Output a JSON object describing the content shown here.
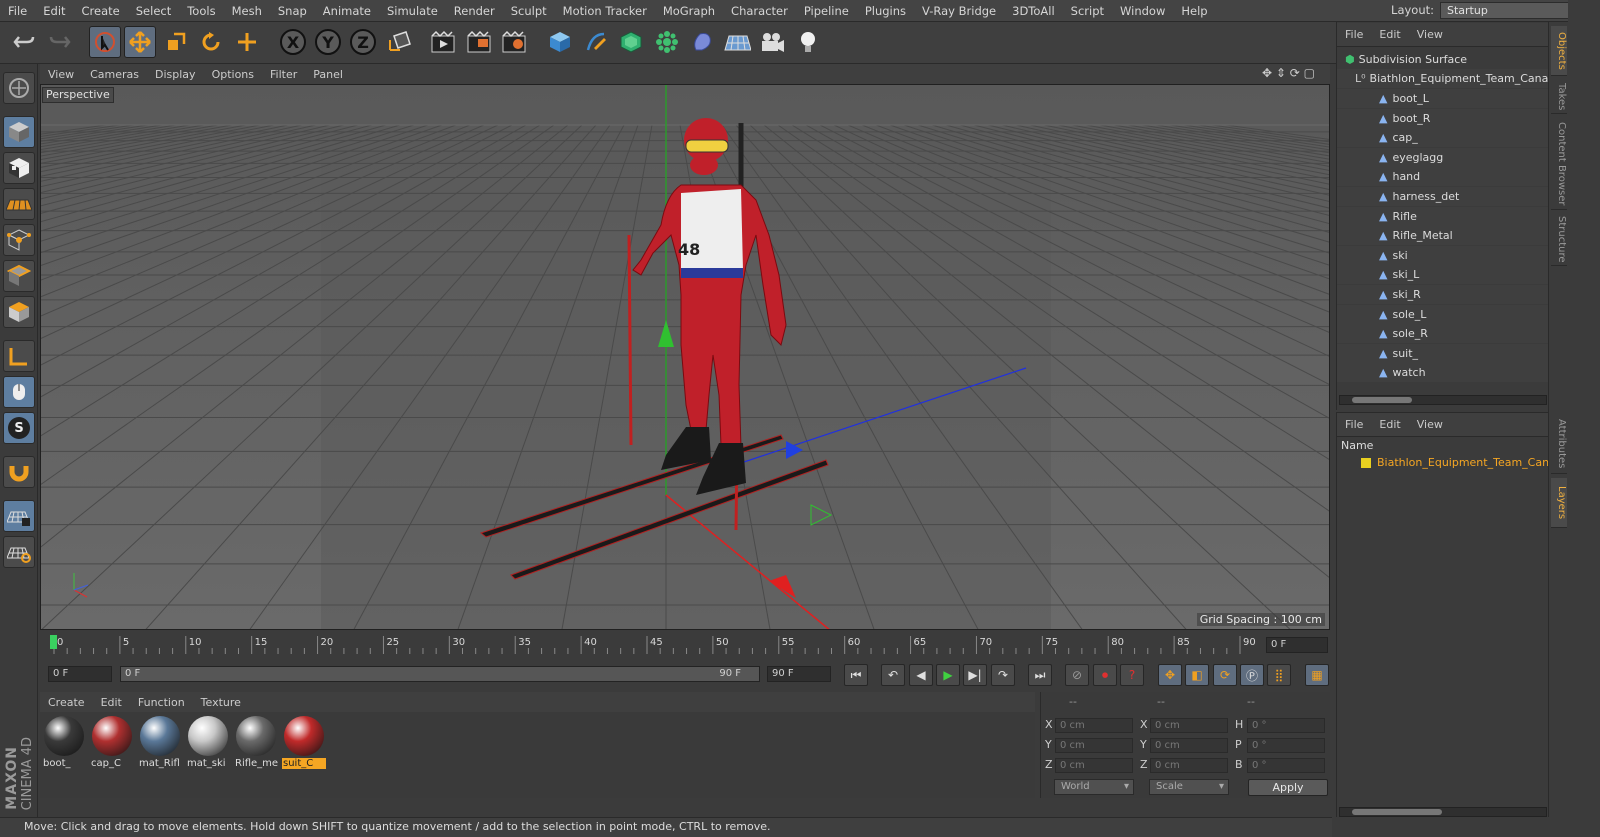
{
  "menubar": {
    "items": [
      "File",
      "Edit",
      "Create",
      "Select",
      "Tools",
      "Mesh",
      "Snap",
      "Animate",
      "Simulate",
      "Render",
      "Sculpt",
      "Motion Tracker",
      "MoGraph",
      "Character",
      "Pipeline",
      "Plugins",
      "V-Ray Bridge",
      "3DToAll",
      "Script",
      "Window",
      "Help"
    ],
    "layout_label": "Layout:",
    "layout_value": "Startup"
  },
  "toolbar": {
    "icons": [
      "undo-icon",
      "redo-icon",
      "select-icon",
      "move-icon",
      "scale-icon",
      "rotate-icon",
      "live-select-icon",
      "x-axis-icon",
      "y-axis-icon",
      "z-axis-icon",
      "coordinate-system-icon",
      "render-view-icon",
      "render-picture-viewer-icon",
      "render-settings-icon",
      "cube-icon",
      "pen-icon",
      "subdivision-icon",
      "cloner-icon",
      "deformer-icon",
      "floor-icon",
      "camera-icon",
      "light-icon"
    ],
    "x_label": "X",
    "y_label": "Y",
    "z_label": "Z"
  },
  "left_tools": [
    "make-editable-icon",
    "model-mode-icon",
    "texture-mode-icon",
    "workplane-icon",
    "points-mode-icon",
    "edges-mode-icon",
    "polygons-mode-icon",
    "axis-mode-icon",
    "tweak-mode-icon",
    "snap-icon",
    "magnet-icon",
    "lock-workplane-icon",
    "planar-workplane-icon"
  ],
  "viewport": {
    "menu": [
      "View",
      "Cameras",
      "Display",
      "Options",
      "Filter",
      "Panel"
    ],
    "label": "Perspective",
    "grid_spacing": "Grid Spacing : 100 cm",
    "bib_number": "48"
  },
  "timeline": {
    "ticks": [
      "0",
      "5",
      "10",
      "15",
      "20",
      "25",
      "30",
      "35",
      "40",
      "45",
      "50",
      "55",
      "60",
      "65",
      "70",
      "75",
      "80",
      "85",
      "90"
    ],
    "current_frame": "0 F",
    "start_frame": "0 F",
    "range_start": "0 F",
    "range_end": "90 F",
    "end_frame": "90 F"
  },
  "materials": {
    "menu": [
      "Create",
      "Edit",
      "Function",
      "Texture"
    ],
    "items": [
      {
        "name": "boot_",
        "color": "#3a3a3a"
      },
      {
        "name": "cap_C",
        "color": "#b03030"
      },
      {
        "name": "mat_Rifl",
        "color": "#5a7898"
      },
      {
        "name": "mat_ski",
        "color": "#c8c8c8"
      },
      {
        "name": "Rifle_me",
        "color": "#6a6a6a"
      },
      {
        "name": "suit_C",
        "color": "#c02a2a"
      }
    ],
    "selected": "suit_C"
  },
  "coordinates": {
    "header": [
      "--",
      "--",
      "--"
    ],
    "rows": [
      {
        "a": "X",
        "av": "0 cm",
        "b": "X",
        "bv": "0 cm",
        "c": "H",
        "cv": "0 °"
      },
      {
        "a": "Y",
        "av": "0 cm",
        "b": "Y",
        "bv": "0 cm",
        "c": "P",
        "cv": "0 °"
      },
      {
        "a": "Z",
        "av": "0 cm",
        "b": "Z",
        "bv": "0 cm",
        "c": "B",
        "cv": "0 °"
      }
    ],
    "space": "World",
    "mode": "Scale",
    "apply": "Apply"
  },
  "status": "Move: Click and drag to move elements. Hold down SHIFT to quantize movement / add to the selection in point mode, CTRL to remove.",
  "brand": {
    "line1": "MAXON",
    "line2": "CINEMA 4D"
  },
  "object_manager": {
    "menu": [
      "File",
      "Edit",
      "View"
    ],
    "root": "Subdivision Surface",
    "group": "Biathlon_Equipment_Team_Cana",
    "children": [
      "boot_L",
      "boot_R",
      "cap_",
      "eyeglagg",
      "hand",
      "harness_det",
      "Rifle",
      "Rifle_Metal",
      "ski",
      "ski_L",
      "ski_R",
      "sole_L",
      "sole_R",
      "suit_",
      "watch"
    ]
  },
  "layer_manager": {
    "menu": [
      "File",
      "Edit",
      "View"
    ],
    "header": "Name",
    "layers": [
      "Biathlon_Equipment_Team_Canad"
    ],
    "layer_color": "#e8d020"
  },
  "side_tabs": [
    "Objects",
    "Takes",
    "Content Browser",
    "Structure",
    "Attributes",
    "Layers"
  ],
  "colors": {
    "accent": "#f5a623",
    "selected_blue": "#5f6d7f"
  }
}
